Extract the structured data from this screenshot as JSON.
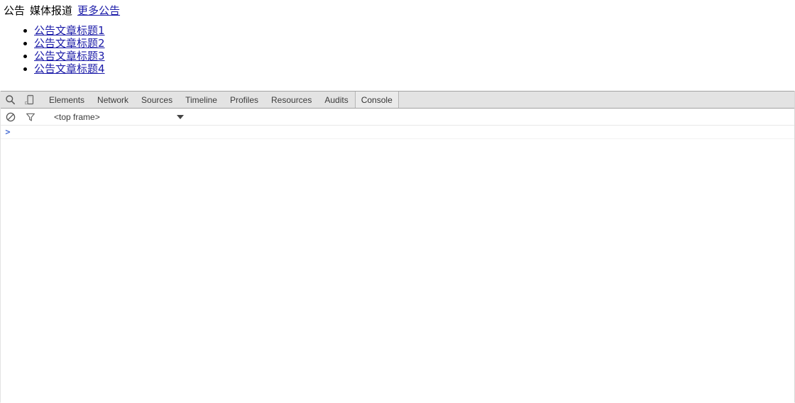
{
  "page": {
    "nav": {
      "item1": "公告",
      "item2": "媒体报道",
      "more_link": "更多公告"
    },
    "announcements": [
      {
        "title": "公告文章标题1"
      },
      {
        "title": "公告文章标题2"
      },
      {
        "title": "公告文章标题3"
      },
      {
        "title": "公告文章标题4"
      }
    ],
    "link_color": "#1a1aa8"
  },
  "devtools": {
    "toolbar_icons": {
      "inspect": "search-icon",
      "device": "mobile-device-icon"
    },
    "tabs": [
      {
        "label": "Elements",
        "selected": false
      },
      {
        "label": "Network",
        "selected": false
      },
      {
        "label": "Sources",
        "selected": false
      },
      {
        "label": "Timeline",
        "selected": false
      },
      {
        "label": "Profiles",
        "selected": false
      },
      {
        "label": "Resources",
        "selected": false
      },
      {
        "label": "Audits",
        "selected": false
      },
      {
        "label": "Console",
        "selected": true
      }
    ],
    "console_toolbar": {
      "clear_icon": "clear-console-icon",
      "filter_icon": "filter-funnel-icon",
      "frame_selector_value": "<top frame>"
    },
    "console": {
      "prompt": ">",
      "input_value": ""
    },
    "colors": {
      "tabbar_bg": "#e3e3e3",
      "tab_selected_bg": "#eaeaea",
      "tabbar_border": "#a3a3a3",
      "prompt_color": "#4a6fd4"
    }
  }
}
